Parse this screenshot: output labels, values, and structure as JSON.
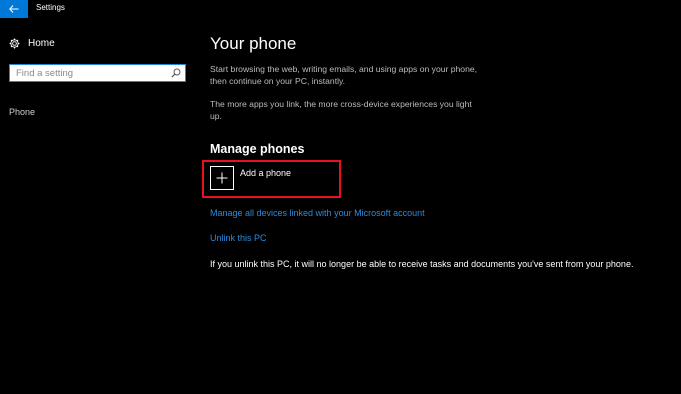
{
  "window": {
    "title": "Settings"
  },
  "sidebar": {
    "home_label": "Home",
    "search_placeholder": "Find a setting",
    "items": [
      {
        "label": "Phone"
      }
    ]
  },
  "main": {
    "title": "Your phone",
    "description_1": "Start browsing the web, writing emails, and using apps on your phone, then continue on your PC, instantly.",
    "description_2": "The more apps you link, the more cross-device experiences you light up.",
    "section_title": "Manage phones",
    "add_phone_label": "Add a phone",
    "manage_link": "Manage all devices linked with your Microsoft account",
    "unlink_link": "Unlink this PC",
    "unlink_note": "If you unlink this PC, it will no longer be able to receive tasks and documents you've sent from your phone."
  },
  "colors": {
    "background": "#000000",
    "accent": "#0078d7",
    "link": "#2b8bdc",
    "highlight": "#e81123"
  },
  "icons": [
    "back-arrow-icon",
    "gear-icon",
    "search-icon",
    "plus-icon"
  ]
}
